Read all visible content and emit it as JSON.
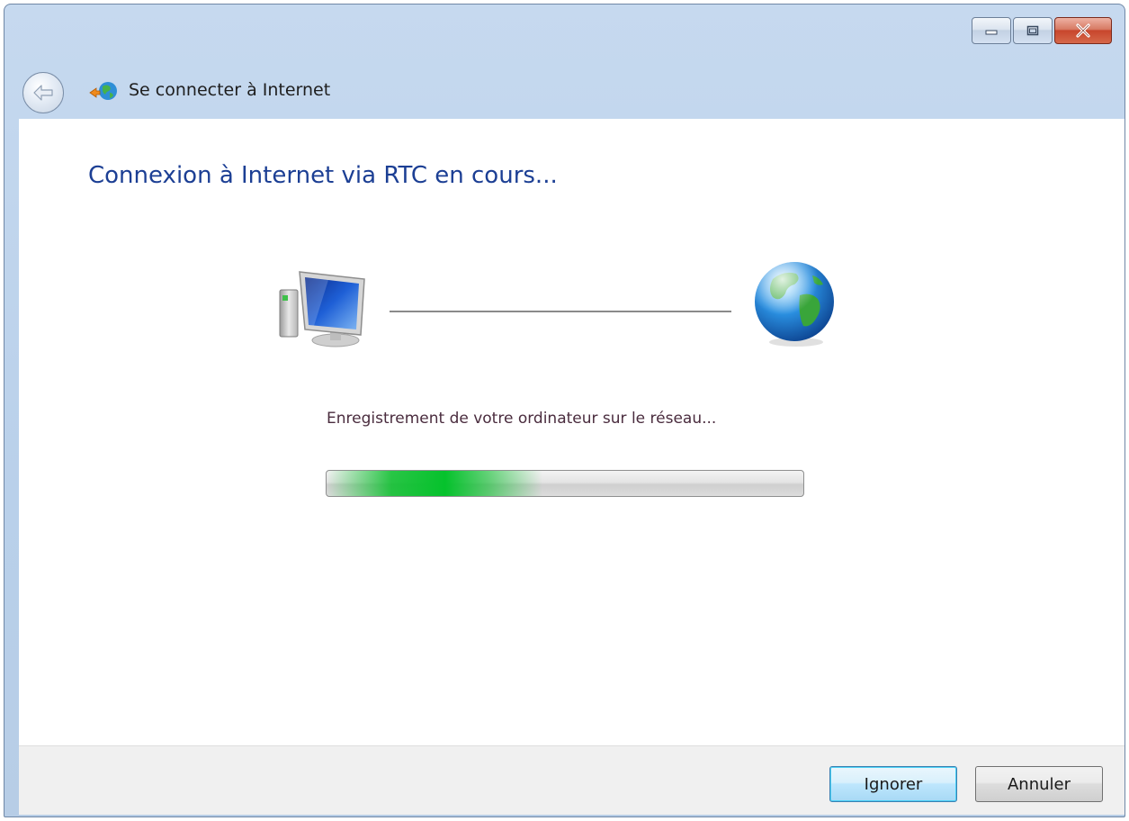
{
  "window": {
    "title": "Se connecter à Internet",
    "caption_buttons": [
      "minimize",
      "maximize",
      "close"
    ]
  },
  "content": {
    "heading": "Connexion à Internet via RTC en cours...",
    "status": "Enregistrement de votre ordinateur sur le réseau...",
    "progress": {
      "state": "indeterminate (marquee)"
    }
  },
  "footer": {
    "ignore_label": "Ignorer",
    "cancel_label": "Annuler"
  },
  "icons": {
    "back": "back-arrow-icon",
    "title": "network-connect-icon",
    "computer": "computer-icon",
    "globe": "globe-icon"
  },
  "colors": {
    "heading": "#1c3f94",
    "progress_green": "#05c22c",
    "default_button_border": "#3c7fb1"
  }
}
